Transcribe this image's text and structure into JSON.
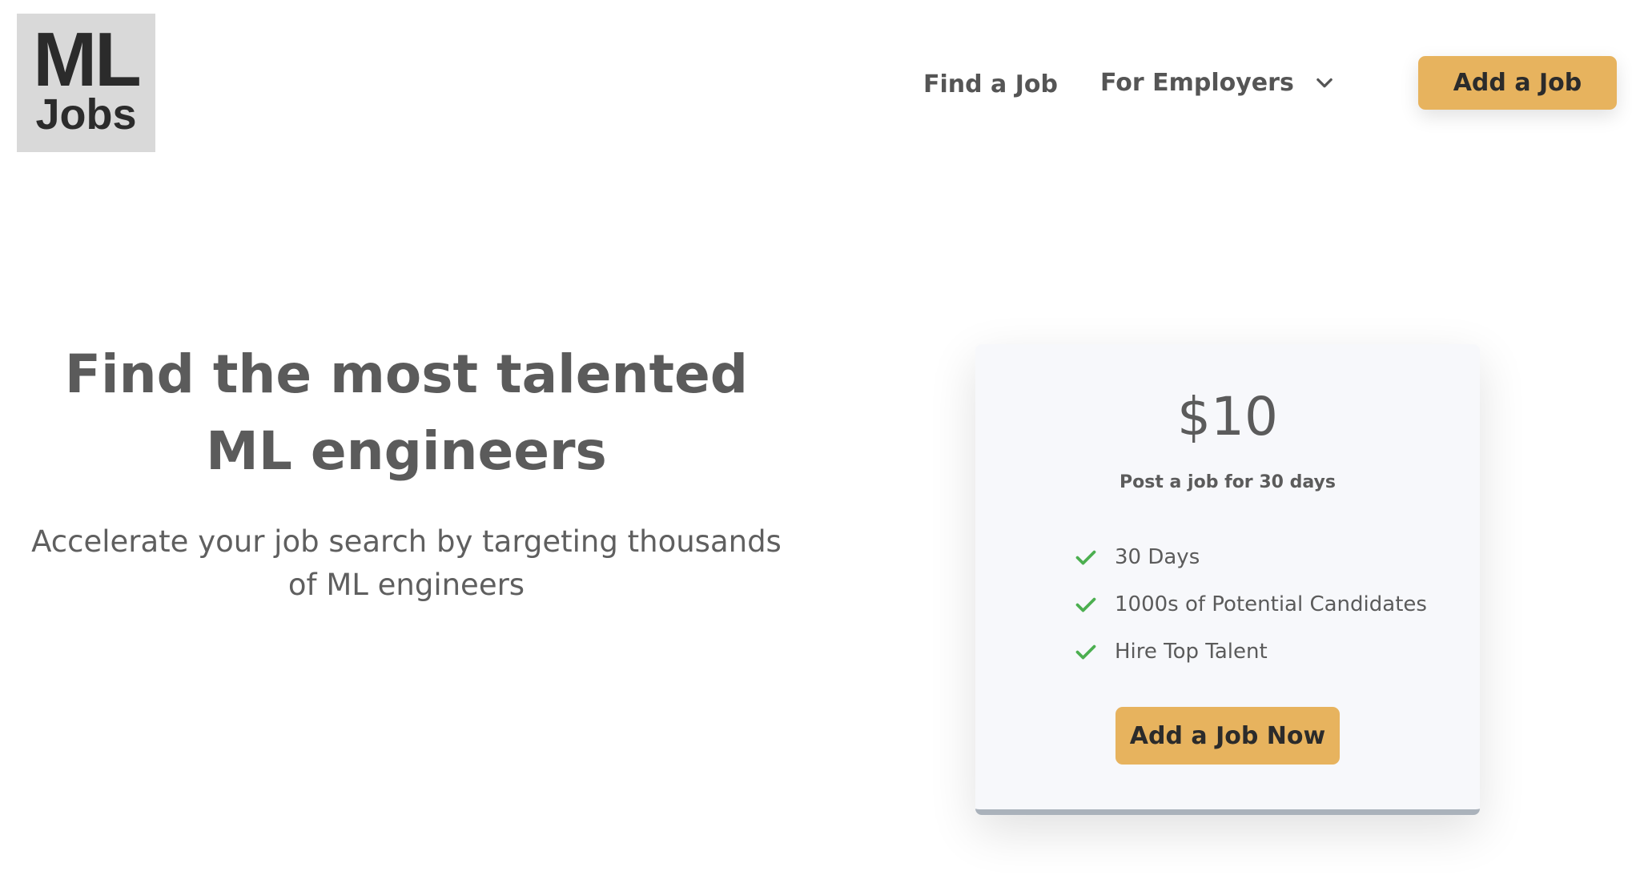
{
  "logo": {
    "line1": "ML",
    "line2": "Jobs"
  },
  "nav": {
    "find_job": "Find a Job",
    "for_employers": "For Employers",
    "add_job": "Add a Job"
  },
  "hero": {
    "title": "Find the most talented ML engineers",
    "subtitle": "Accelerate your job search by targeting thousands of ML engineers"
  },
  "pricing": {
    "price": "$10",
    "description": "Post a job for 30 days",
    "features": [
      {
        "label": "30 Days",
        "icon": "check-icon"
      },
      {
        "label": "1000s of Potential Candidates",
        "icon": "check-icon"
      },
      {
        "label": "Hire Top Talent",
        "icon": "check-icon"
      }
    ],
    "cta": "Add a Job Now"
  },
  "colors": {
    "accent": "#e7b35e",
    "check": "#4caf50",
    "text": "#5b5b5b",
    "logo_bg": "#d9d9d9",
    "card_bg": "#f7f8fb",
    "card_border": "#aab2bb"
  }
}
